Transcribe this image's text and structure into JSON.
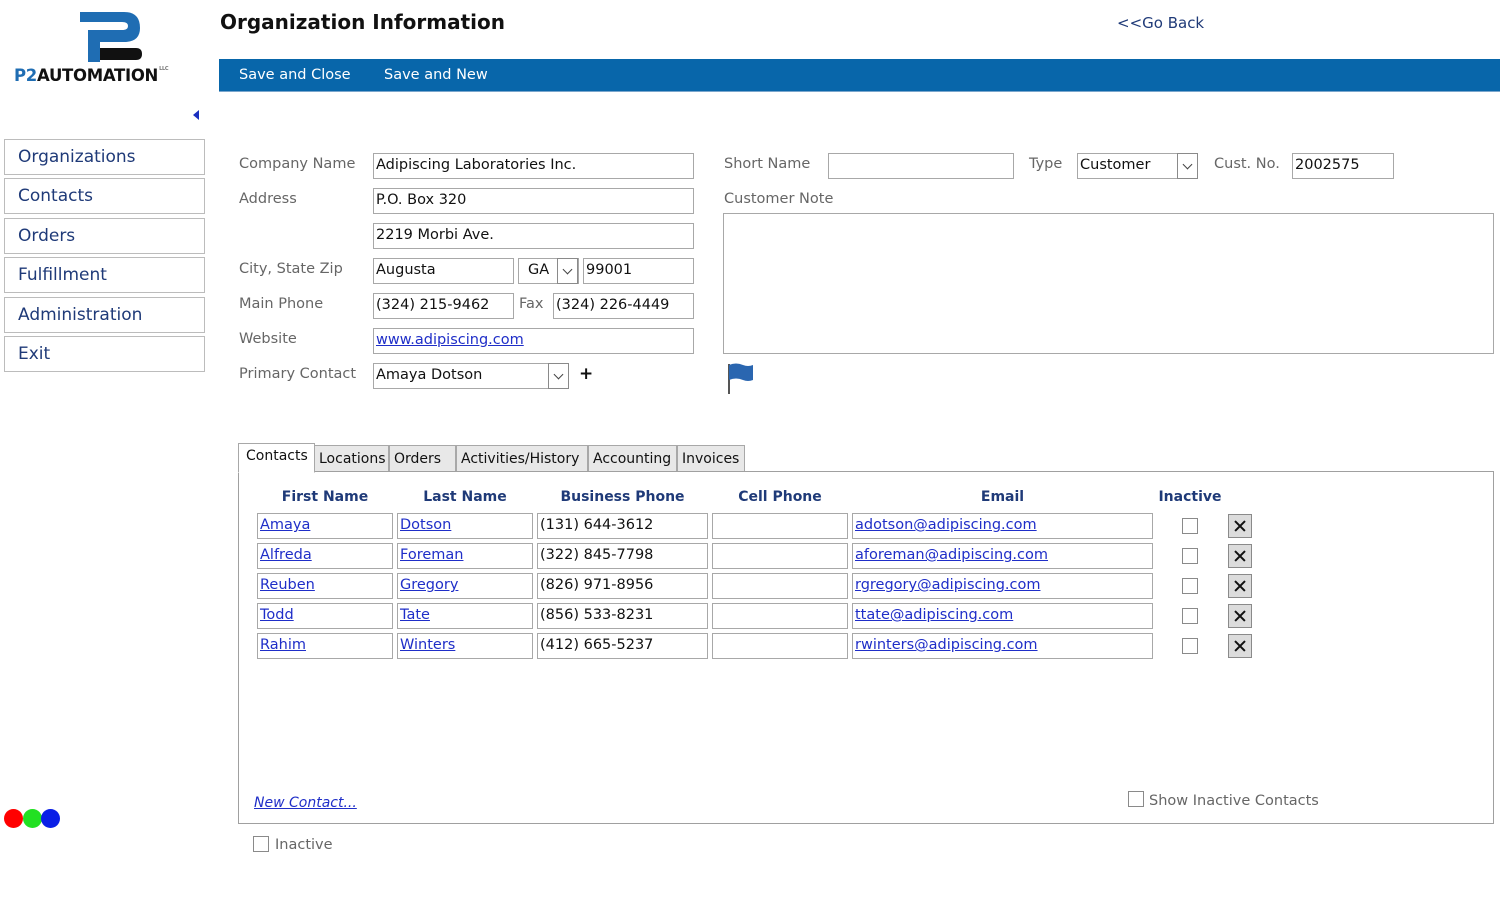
{
  "brand": {
    "logo_prefix": "P2",
    "logo_name": "AUTOMATION",
    "logo_suffix": "LLC",
    "primary_color": "#1f6db3"
  },
  "header": {
    "title": "Organization Information",
    "go_back": "<<Go Back"
  },
  "toolbar": {
    "save_close_label": "Save and Close",
    "save_new_label": "Save and New",
    "background": "#0866aa"
  },
  "sidebar": {
    "items": [
      {
        "label": "Organizations"
      },
      {
        "label": "Contacts"
      },
      {
        "label": "Orders"
      },
      {
        "label": "Fulfillment"
      },
      {
        "label": "Administration"
      },
      {
        "label": "Exit"
      }
    ]
  },
  "status_dots": [
    "#ff0000",
    "#22e022",
    "#0a1fe6"
  ],
  "form": {
    "company_name": {
      "label": "Company Name",
      "value": "Adipiscing Laboratories Inc."
    },
    "address": {
      "label": "Address",
      "line1": "P.O. Box 320",
      "line2": "2219 Morbi Ave."
    },
    "city_state_zip": {
      "label": "City, State Zip",
      "city": "Augusta",
      "state": "GA",
      "zip": "99001"
    },
    "main_phone": {
      "label": "Main Phone",
      "value": "(324) 215-9462"
    },
    "fax": {
      "label": "Fax",
      "value": "(324) 226-4449"
    },
    "website": {
      "label": "Website",
      "value": "www.adipiscing.com"
    },
    "primary_contact": {
      "label": "Primary Contact",
      "value": "Amaya Dotson",
      "add_label": "+"
    },
    "short_name": {
      "label": "Short Name",
      "value": ""
    },
    "type": {
      "label": "Type",
      "value": "Customer"
    },
    "cust_no": {
      "label": "Cust. No.",
      "value": "2002575"
    },
    "customer_note": {
      "label": "Customer Note",
      "value": ""
    },
    "inactive_label": "Inactive"
  },
  "tabs": [
    {
      "label": "Contacts",
      "active": true
    },
    {
      "label": "Locations"
    },
    {
      "label": "Orders"
    },
    {
      "label": "Activities/History"
    },
    {
      "label": "Accounting"
    },
    {
      "label": "Invoices"
    }
  ],
  "contacts": {
    "columns": [
      "First Name",
      "Last Name",
      "Business Phone",
      "Cell Phone",
      "Email",
      "Inactive"
    ],
    "rows": [
      {
        "first": "Amaya",
        "last": "Dotson",
        "business_phone": "(131) 644-3612",
        "cell_phone": "",
        "email": "adotson@adipiscing.com",
        "inactive": false
      },
      {
        "first": "Alfreda",
        "last": "Foreman",
        "business_phone": "(322) 845-7798",
        "cell_phone": "",
        "email": "aforeman@adipiscing.com",
        "inactive": false
      },
      {
        "first": "Reuben",
        "last": "Gregory",
        "business_phone": "(826) 971-8956",
        "cell_phone": "",
        "email": "rgregory@adipiscing.com",
        "inactive": false
      },
      {
        "first": "Todd",
        "last": "Tate",
        "business_phone": "(856) 533-8231",
        "cell_phone": "",
        "email": "ttate@adipiscing.com",
        "inactive": false
      },
      {
        "first": "Rahim",
        "last": "Winters",
        "business_phone": "(412) 665-5237",
        "cell_phone": "",
        "email": "rwinters@adipiscing.com",
        "inactive": false
      }
    ],
    "new_contact_label": "New Contact...",
    "show_inactive_label": "Show Inactive Contacts"
  }
}
